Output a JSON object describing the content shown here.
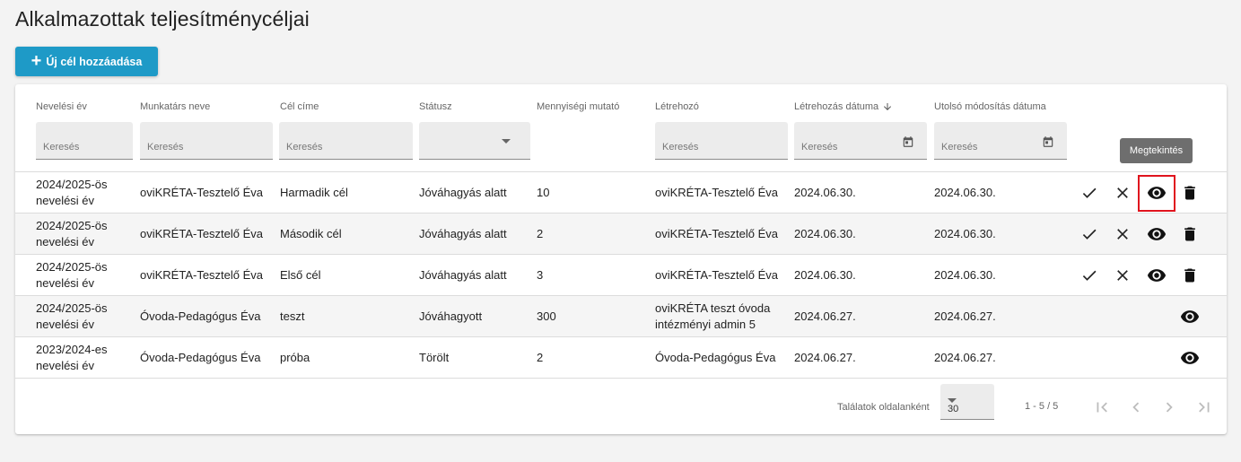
{
  "page": {
    "title": "Alkalmazottak teljesítménycéljai",
    "add_button_label": "Új cél hozzáadása"
  },
  "table": {
    "columns": [
      {
        "label": "Nevelési év"
      },
      {
        "label": "Munkatárs neve"
      },
      {
        "label": "Cél címe"
      },
      {
        "label": "Státusz"
      },
      {
        "label": "Mennyiségi mutató"
      },
      {
        "label": "Létrehozó"
      },
      {
        "label": "Létrehozás dátuma",
        "sort": "descending"
      },
      {
        "label": "Utolsó módosítás dátuma"
      }
    ],
    "filter_placeholder": "Keresés",
    "status_filter_value": "",
    "rows": [
      {
        "year_line1": "2024/2025-ös",
        "year_line2": "nevelési év",
        "employee": "oviKRÉTA-Tesztelő Éva",
        "goal": "Harmadik cél",
        "status": "Jóváhagyás alatt",
        "quantity": "10",
        "creator_line1": "oviKRÉTA-Tesztelő Éva",
        "creator_line2": "",
        "created": "2024.06.30.",
        "modified": "2024.06.30.",
        "actions": [
          "approve",
          "reject",
          "view",
          "delete"
        ]
      },
      {
        "year_line1": "2024/2025-ös",
        "year_line2": "nevelési év",
        "employee": "oviKRÉTA-Tesztelő Éva",
        "goal": "Második cél",
        "status": "Jóváhagyás alatt",
        "quantity": "2",
        "creator_line1": "oviKRÉTA-Tesztelő Éva",
        "creator_line2": "",
        "created": "2024.06.30.",
        "modified": "2024.06.30.",
        "actions": [
          "approve",
          "reject",
          "view",
          "delete"
        ]
      },
      {
        "year_line1": "2024/2025-ös",
        "year_line2": "nevelési év",
        "employee": "oviKRÉTA-Tesztelő Éva",
        "goal": "Első cél",
        "status": "Jóváhagyás alatt",
        "quantity": "3",
        "creator_line1": "oviKRÉTA-Tesztelő Éva",
        "creator_line2": "",
        "created": "2024.06.30.",
        "modified": "2024.06.30.",
        "actions": [
          "approve",
          "reject",
          "view",
          "delete"
        ]
      },
      {
        "year_line1": "2024/2025-ös",
        "year_line2": "nevelési év",
        "employee": "Óvoda-Pedagógus Éva",
        "goal": "teszt",
        "status": "Jóváhagyott",
        "quantity": "300",
        "creator_line1": "oviKRÉTA teszt óvoda",
        "creator_line2": "intézményi admin 5",
        "created": "2024.06.27.",
        "modified": "2024.06.27.",
        "actions": [
          "view"
        ]
      },
      {
        "year_line1": "2023/2024-es",
        "year_line2": "nevelési év",
        "employee": "Óvoda-Pedagógus Éva",
        "goal": "próba",
        "status": "Törölt",
        "quantity": "2",
        "creator_line1": "Óvoda-Pedagógus Éva",
        "creator_line2": "",
        "created": "2024.06.27.",
        "modified": "2024.06.27.",
        "actions": [
          "view"
        ]
      }
    ]
  },
  "tooltip": {
    "text": "Megtekintés"
  },
  "pagination": {
    "per_page_label": "Találatok oldalanként",
    "per_page_value": "30",
    "range": "1 - 5 / 5"
  },
  "icons": {
    "approve": "check-icon",
    "reject": "close-icon",
    "view": "eye-icon",
    "delete": "trash-icon",
    "date_filter": "calendar-icon",
    "sort": "arrow-down-icon"
  },
  "colors": {
    "accent": "#1e9ac7",
    "highlight": "#e0141e",
    "tooltip_bg": "#6e6e6e"
  }
}
